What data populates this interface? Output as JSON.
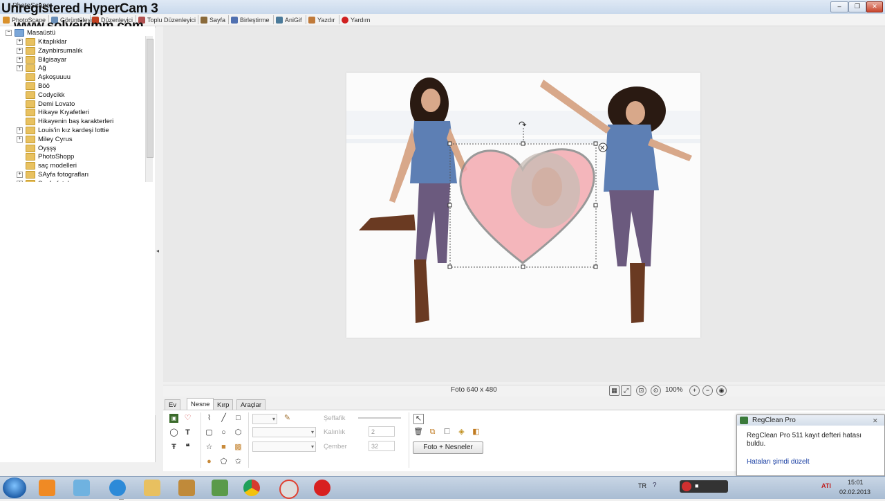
{
  "window": {
    "title": "PhotoScape"
  },
  "watermark": {
    "line1": "Unregistered HyperCam 3",
    "line2": "www.solveigmm.com"
  },
  "menu": [
    {
      "label": "PhotoScape",
      "icon": "photoscape-icon",
      "color": "#d9902a"
    },
    {
      "label": "Görüntüleyici",
      "icon": "viewer-icon",
      "color": "#6a8fb8"
    },
    {
      "label": "Düzenleyici",
      "icon": "editor-icon",
      "color": "#c04020"
    },
    {
      "label": "Toplu Düzenleyici",
      "icon": "batch-editor-icon",
      "color": "#b05050"
    },
    {
      "label": "Sayfa",
      "icon": "page-icon",
      "color": "#8a6a3a"
    },
    {
      "label": "Birleştirme",
      "icon": "combine-icon",
      "color": "#5070b0"
    },
    {
      "label": "AniGif",
      "icon": "anigif-icon",
      "color": "#4a7a9a"
    },
    {
      "label": "Yazdır",
      "icon": "print-icon",
      "color": "#c07a3a"
    },
    {
      "label": "Yardım",
      "icon": "help-icon",
      "color": "#d02020"
    }
  ],
  "tree": {
    "root": "Masaüstü",
    "items": [
      {
        "label": "Kitaplıklar",
        "expandable": true
      },
      {
        "label": "Zaynbirsumalık",
        "expandable": true
      },
      {
        "label": "Bilgisayar",
        "expandable": true
      },
      {
        "label": "Ağ",
        "expandable": true
      },
      {
        "label": "Aşkoşuuuu",
        "expandable": false
      },
      {
        "label": "Böö",
        "expandable": false
      },
      {
        "label": "Codycikk",
        "expandable": false
      },
      {
        "label": "Demi Lovato",
        "expandable": false
      },
      {
        "label": "Hikaye Kıyafetleri",
        "expandable": false
      },
      {
        "label": "Hikayenin baş karakterleri",
        "expandable": false
      },
      {
        "label": "Louis'in kız kardeşi lottie",
        "expandable": true
      },
      {
        "label": "Miley Cyrus",
        "expandable": true
      },
      {
        "label": "Oyşşş",
        "expandable": false
      },
      {
        "label": "PhotoShopp",
        "expandable": false
      },
      {
        "label": "saç modelleri",
        "expandable": false
      },
      {
        "label": "SAyfa fotografları",
        "expandable": true
      },
      {
        "label": "Sayfa fotoları",
        "expandable": true
      }
    ]
  },
  "status": {
    "image_size": "Foto 640 x 480",
    "zoom": "100%"
  },
  "tabs": [
    "Ev",
    "Nesne",
    "Kırp",
    "Araçlar"
  ],
  "active_tab": "Nesne",
  "object_panel": {
    "transparency_label": "Şeffafik",
    "thickness_label": "Kalınlık",
    "thickness_value": "2",
    "circle_label": "Çember",
    "circle_value": "32",
    "photo_objects_button": "Foto + Nesneler"
  },
  "notification": {
    "title": "RegClean Pro",
    "body": "RegClean Pro 511 kayıt defteri hatası buldu.",
    "link": "Hataları şimdi düzelt"
  },
  "tray": {
    "language": "TR",
    "time": "15:01",
    "date": "02.02.2013"
  },
  "colors": {
    "accent": "#1a3fa3",
    "taskbar": "#b3c4d9",
    "heart": "#f07a85"
  }
}
